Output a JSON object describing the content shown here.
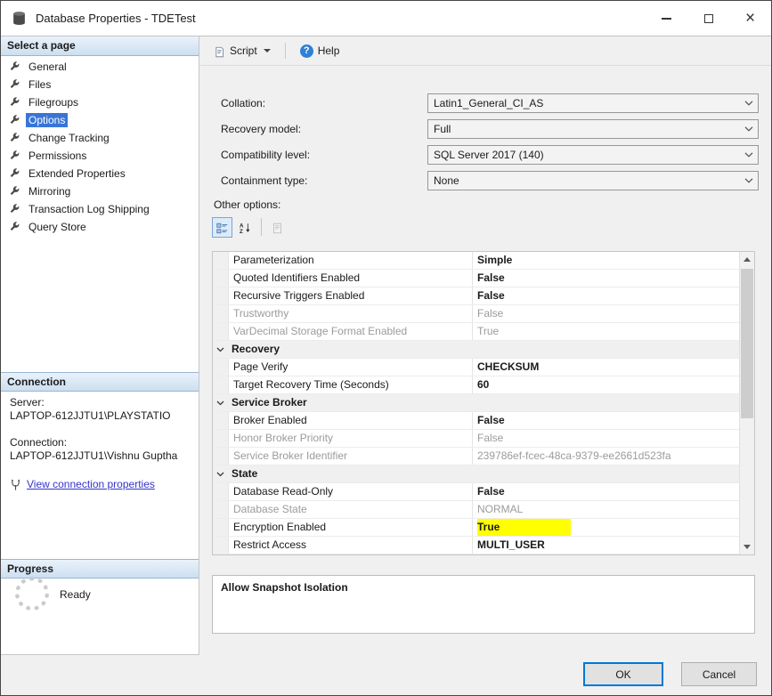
{
  "window": {
    "title": "Database Properties - TDETest"
  },
  "colors": {
    "selection_blue": "#3875d7",
    "highlight_yellow": "#ffff00",
    "link_blue": "#3333cc",
    "default_button_border": "#0078d7"
  },
  "icons": {
    "titlebar_app": "database-icon",
    "sidebar_item": "wrench-icon",
    "toolbar": [
      "script-file-icon",
      "help-question-icon"
    ],
    "connection_link": "connection-properties-icon",
    "progress": "spinner-icon",
    "grid_toolbar": [
      "categorized-icon",
      "alphabetical-sort-icon",
      "property-pages-icon"
    ],
    "window_controls": [
      "minimize-icon",
      "maximize-icon",
      "close-icon"
    ]
  },
  "sidebar": {
    "select_page_header": "Select a page",
    "pages": [
      {
        "label": "General",
        "selected": false
      },
      {
        "label": "Files",
        "selected": false
      },
      {
        "label": "Filegroups",
        "selected": false
      },
      {
        "label": "Options",
        "selected": true
      },
      {
        "label": "Change Tracking",
        "selected": false
      },
      {
        "label": "Permissions",
        "selected": false
      },
      {
        "label": "Extended Properties",
        "selected": false
      },
      {
        "label": "Mirroring",
        "selected": false
      },
      {
        "label": "Transaction Log Shipping",
        "selected": false
      },
      {
        "label": "Query Store",
        "selected": false
      }
    ],
    "connection_header": "Connection",
    "server_label": "Server:",
    "server_value": "LAPTOP-612JJTU1\\PLAYSTATIO",
    "connection_label": "Connection:",
    "connection_value": "LAPTOP-612JJTU1\\Vishnu Guptha",
    "view_connection_link": "View connection properties",
    "progress_header": "Progress",
    "progress_status": "Ready"
  },
  "toolbar": {
    "script_label": "Script",
    "help_label": "Help"
  },
  "form": {
    "fields": [
      {
        "label": "Collation:",
        "value": "Latin1_General_CI_AS"
      },
      {
        "label": "Recovery model:",
        "value": "Full"
      },
      {
        "label": "Compatibility level:",
        "value": "SQL Server 2017 (140)"
      },
      {
        "label": "Containment type:",
        "value": "None"
      }
    ],
    "other_options_label": "Other options:"
  },
  "property_grid": {
    "rows": [
      {
        "type": "property",
        "name": "Parameterization",
        "value": "Simple",
        "state": "bold"
      },
      {
        "type": "property",
        "name": "Quoted Identifiers Enabled",
        "value": "False",
        "state": "bold"
      },
      {
        "type": "property",
        "name": "Recursive Triggers Enabled",
        "value": "False",
        "state": "bold"
      },
      {
        "type": "property",
        "name": "Trustworthy",
        "value": "False",
        "state": "disabled"
      },
      {
        "type": "property",
        "name": "VarDecimal Storage Format Enabled",
        "value": "True",
        "state": "disabled"
      },
      {
        "type": "category",
        "name": "Recovery"
      },
      {
        "type": "property",
        "name": "Page Verify",
        "value": "CHECKSUM",
        "state": "bold"
      },
      {
        "type": "property",
        "name": "Target Recovery Time (Seconds)",
        "value": "60",
        "state": "bold"
      },
      {
        "type": "category",
        "name": "Service Broker"
      },
      {
        "type": "property",
        "name": "Broker Enabled",
        "value": "False",
        "state": "bold"
      },
      {
        "type": "property",
        "name": "Honor Broker Priority",
        "value": "False",
        "state": "disabled"
      },
      {
        "type": "property",
        "name": "Service Broker Identifier",
        "value": "239786ef-fcec-48ca-9379-ee2661d523fa",
        "state": "disabled"
      },
      {
        "type": "category",
        "name": "State"
      },
      {
        "type": "property",
        "name": "Database Read-Only",
        "value": "False",
        "state": "bold"
      },
      {
        "type": "property",
        "name": "Database State",
        "value": "NORMAL",
        "state": "disabled"
      },
      {
        "type": "property",
        "name": "Encryption Enabled",
        "value": "True",
        "state": "bold",
        "highlighted": true
      },
      {
        "type": "property",
        "name": "Restrict Access",
        "value": "MULTI_USER",
        "state": "bold"
      }
    ],
    "description_title": "Allow Snapshot Isolation"
  },
  "footer": {
    "ok_label": "OK",
    "cancel_label": "Cancel"
  }
}
